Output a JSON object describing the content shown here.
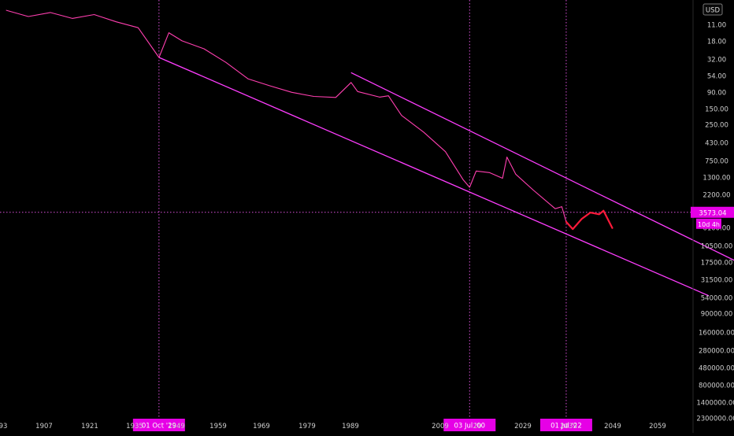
{
  "chart_data": {
    "type": "line",
    "title": "",
    "currency_badge": "USD",
    "y_scale": "log",
    "y_inverted": true,
    "y_ticks": [
      "6.5",
      "11.00",
      "18.00",
      "32.00",
      "54.00",
      "90.00",
      "150.00",
      "250.00",
      "430.00",
      "750.00",
      "1300.00",
      "2200.00",
      "6100.00",
      "10500.00",
      "17500.00",
      "31500.00",
      "54000.00",
      "90000.00",
      "160000.00",
      "280000.00",
      "480000.00",
      "800000.00",
      "1400000.00",
      "2300000.00"
    ],
    "x_ticks": [
      "93",
      "1907",
      "1921",
      "1935",
      "1949",
      "1959",
      "1969",
      "1979",
      "1989",
      "2009",
      "20",
      "2029",
      "2039",
      "2049",
      "2059"
    ],
    "x_range": [
      1893,
      2070
    ],
    "vertical_markers": [
      {
        "label": "01 Oct '29",
        "year": 1929.75
      },
      {
        "label": "03 Jul '00",
        "year": 2000.5
      },
      {
        "label": "01 Jul '22",
        "year": 2022.5
      }
    ],
    "crosshair": {
      "price_label": "3573.04",
      "countdown_label": "10d 4h",
      "value": 3573.04
    },
    "series": [
      {
        "x": [
          1895,
          1900,
          1905,
          1910,
          1915,
          1920,
          1925,
          1929.75,
          1932,
          1935,
          1940,
          1945,
          1950,
          1955,
          1960,
          1965,
          1970,
          1973.5,
          1975,
          1980,
          1982,
          1985,
          1990,
          1995,
          1999,
          2000.5,
          2002,
          2005,
          2008,
          2009,
          2011,
          2015,
          2020,
          2021.5,
          2022.5
        ],
        "values": [
          7,
          8.5,
          7.5,
          9,
          8,
          10,
          12,
          30,
          14,
          18,
          23,
          35,
          58,
          72,
          88,
          100,
          103,
          65,
          86,
          102,
          98,
          180,
          300,
          550,
          1300,
          1650,
          1000,
          1050,
          1250,
          650,
          1100,
          1800,
          3200,
          3000,
          4800
        ]
      },
      {
        "x": [
          2022.5,
          2024,
          2026,
          2028,
          2030,
          2031,
          2033
        ],
        "values": [
          4800,
          6000,
          4400,
          3600,
          3800,
          3400,
          5800
        ]
      }
    ],
    "trendlines": [
      {
        "x": [
          1929.75,
          2055
        ],
        "values": [
          30,
          47000
        ]
      },
      {
        "x": [
          1973.5,
          2070
        ],
        "values": [
          48,
          29000
        ]
      }
    ]
  }
}
